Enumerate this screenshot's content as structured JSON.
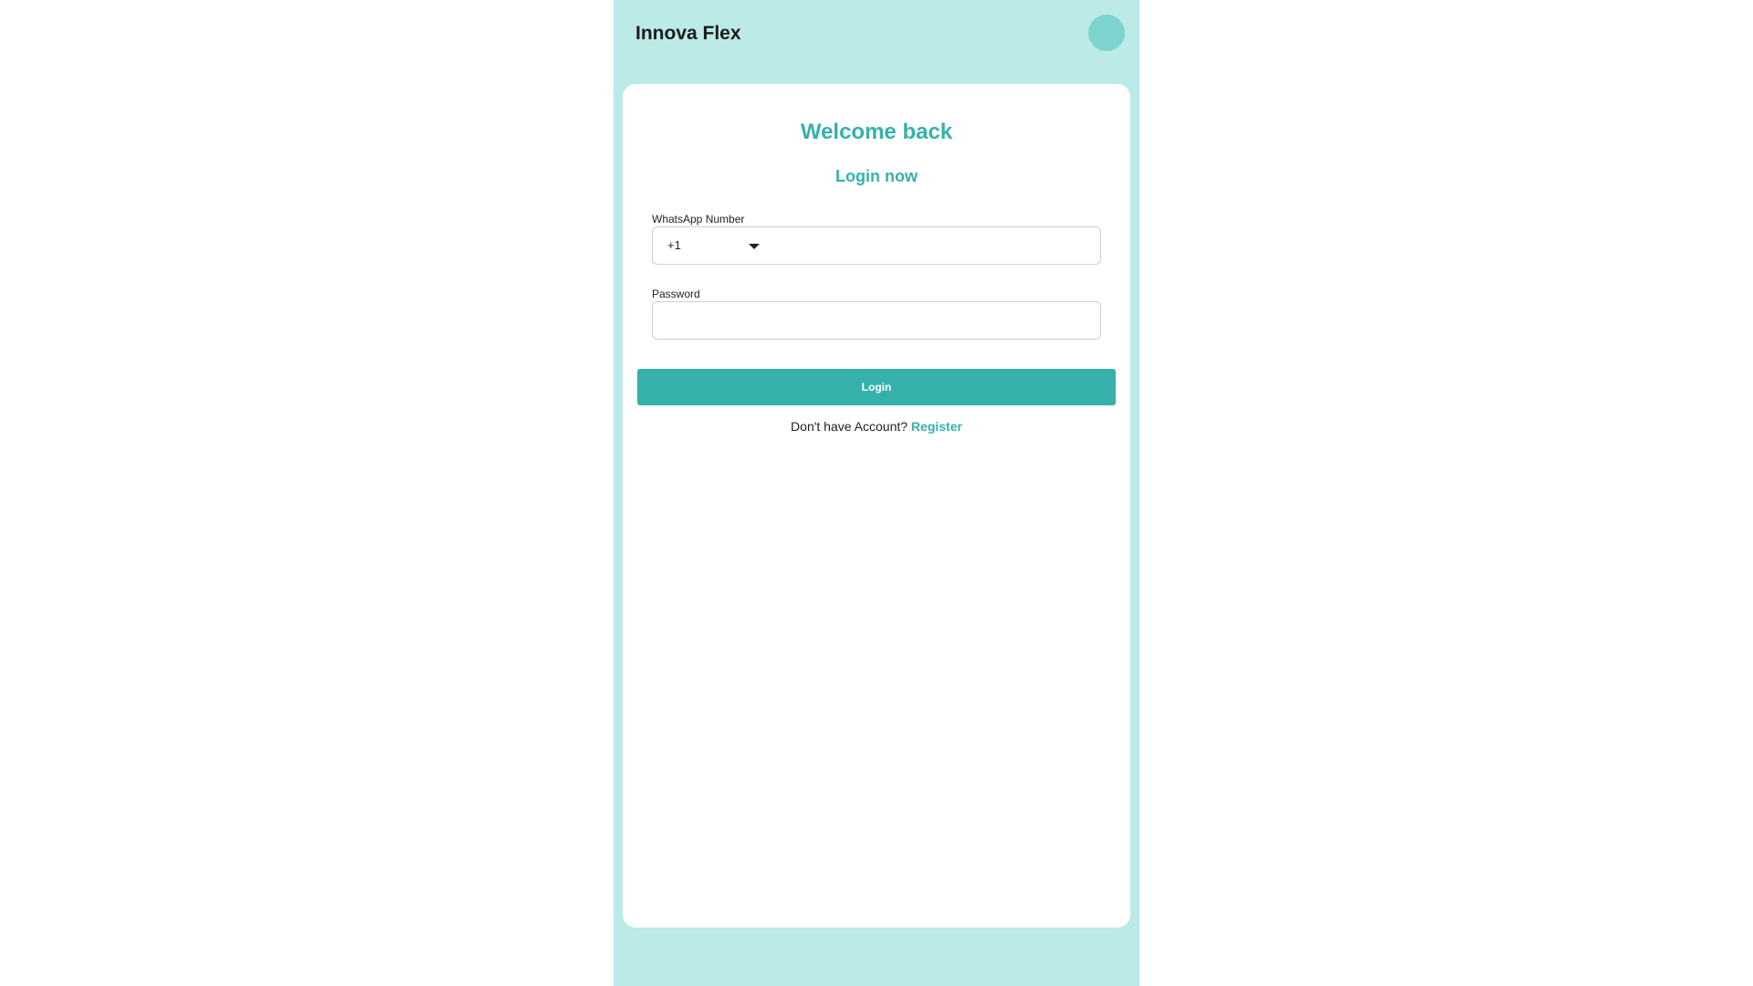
{
  "app": {
    "title": "Innova Flex"
  },
  "colors": {
    "accent": "#36b1aa",
    "frame_background": "#bbeae7",
    "avatar": "#7dd4cf",
    "card_background": "#ffffff"
  },
  "login": {
    "heading": "Welcome back",
    "subheading": "Login now",
    "whatsapp": {
      "label": "WhatsApp Number",
      "country_code": "+1",
      "value": "",
      "placeholder": ""
    },
    "password": {
      "label": "Password",
      "value": "",
      "placeholder": ""
    },
    "login_button_label": "Login",
    "register_prompt": "Don't have Account?",
    "register_link_label": "Register"
  },
  "icons": {
    "avatar": "avatar",
    "country_dropdown": "chevron-down-icon"
  }
}
